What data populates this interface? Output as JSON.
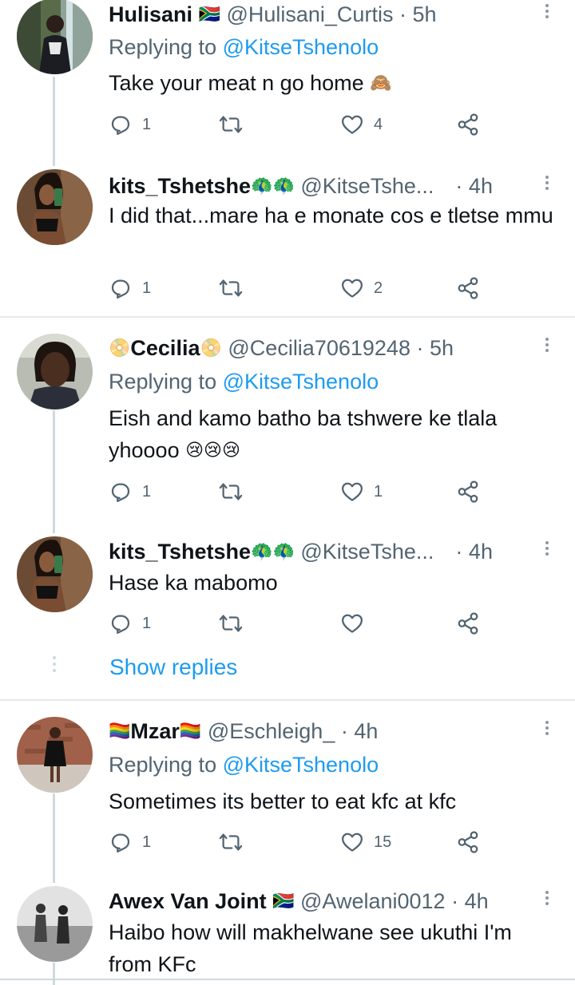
{
  "tweets": [
    {
      "name": "Hulisani",
      "name_emoji": "🇿🇦",
      "handle": "@Hulisani_Curtis",
      "time": "5h",
      "replying_to_prefix": "Replying to ",
      "replying_to": "@KitseTshenolo",
      "text": "Take your meat n go home",
      "text_emoji": "🙈",
      "replies": "1",
      "retweets": "",
      "likes": "4"
    },
    {
      "name": "kits_Tshetshe",
      "name_emoji": "🦚🦚",
      "handle": "@KitseTshe...",
      "time": "4h",
      "text": "I did that...mare ha e monate cos e tletse mmu",
      "replies": "1",
      "retweets": "",
      "likes": "2"
    },
    {
      "name": "Cecilia",
      "name_emoji_before": "📀",
      "name_emoji": "📀",
      "handle": "@Cecilia70619248",
      "time": "5h",
      "replying_to_prefix": "Replying to ",
      "replying_to": "@KitseTshenolo",
      "text": "Eish and kamo batho ba tshwere ke tlala yhoooo",
      "text_emoji": "😢😢😢",
      "replies": "1",
      "retweets": "",
      "likes": "1"
    },
    {
      "name": "kits_Tshetshe",
      "name_emoji": "🦚🦚",
      "handle": "@KitseTshe...",
      "time": "4h",
      "text": "Hase ka mabomo",
      "replies": "1",
      "retweets": "",
      "likes": ""
    },
    {
      "name": "Mzar",
      "name_emoji_before": "🏳️‍🌈",
      "name_emoji": "🏳️‍🌈",
      "handle": "@Eschleigh_",
      "time": "4h",
      "replying_to_prefix": "Replying to ",
      "replying_to": "@KitseTshenolo",
      "text": "Sometimes its better to eat kfc at kfc",
      "replies": "1",
      "retweets": "",
      "likes": "15"
    },
    {
      "name": "Awex Van Joint",
      "name_emoji": "🇿🇦",
      "handle": "@Awelani0012",
      "time": "4h",
      "text": "Haibo how will makhelwane see ukuthi I'm from KFc"
    }
  ],
  "show_replies": "Show replies",
  "separator": "·",
  "icons": {
    "reply": "reply-icon",
    "retweet": "retweet-icon",
    "like": "heart-icon",
    "share": "share-icon",
    "more": "more-options-icon"
  },
  "colors": {
    "text": "#0f1419",
    "secondary": "#536471",
    "link": "#1d9bf0",
    "divider": "#e7e9ea",
    "thread": "#cfd9de"
  }
}
